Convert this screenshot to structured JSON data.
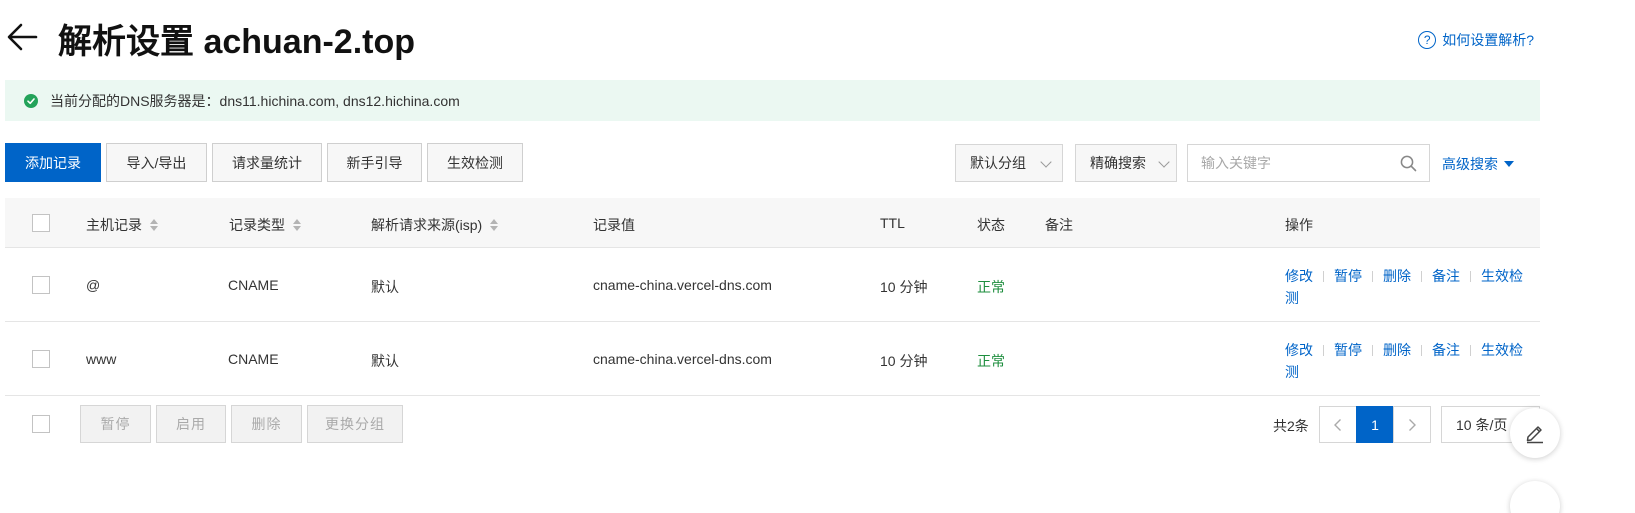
{
  "header": {
    "title": "解析设置 achuan-2.top",
    "help_label": "如何设置解析?",
    "help_icon_glyph": "?"
  },
  "notice": {
    "text": "当前分配的DNS服务器是：dns11.hichina.com, dns12.hichina.com",
    "status_color": "#23a35a"
  },
  "toolbar": {
    "add_record": "添加记录",
    "import_export": "导入/导出",
    "request_stats": "请求量统计",
    "beginner_guide": "新手引导",
    "effect_check": "生效检测",
    "group_select": "默认分组",
    "search_mode": "精确搜索",
    "search_placeholder": "输入关键字",
    "advanced_search": "高级搜索"
  },
  "table": {
    "columns": {
      "host": "主机记录",
      "type": "记录类型",
      "isp": "解析请求来源(isp)",
      "value": "记录值",
      "ttl": "TTL",
      "status": "状态",
      "remark": "备注",
      "actions": "操作"
    },
    "rows": [
      {
        "host": "@",
        "type": "CNAME",
        "isp": "默认",
        "value": "cname-china.vercel-dns.com",
        "ttl": "10 分钟",
        "status": "正常",
        "remark": ""
      },
      {
        "host": "www",
        "type": "CNAME",
        "isp": "默认",
        "value": "cname-china.vercel-dns.com",
        "ttl": "10 分钟",
        "status": "正常",
        "remark": ""
      }
    ],
    "row_actions": {
      "modify": "修改",
      "pause": "暂停",
      "delete": "删除",
      "remark": "备注",
      "check_a": "生效检",
      "check_b": "测"
    }
  },
  "footer": {
    "pause": "暂停",
    "enable": "启用",
    "delete": "删除",
    "change_group": "更换分组",
    "total": "共2条",
    "current_page": "1",
    "page_size": "10 条/页"
  },
  "colors": {
    "accent": "#0064c8",
    "status_ok": "#1e8e3e",
    "notice_bg": "#ebf8f2"
  }
}
